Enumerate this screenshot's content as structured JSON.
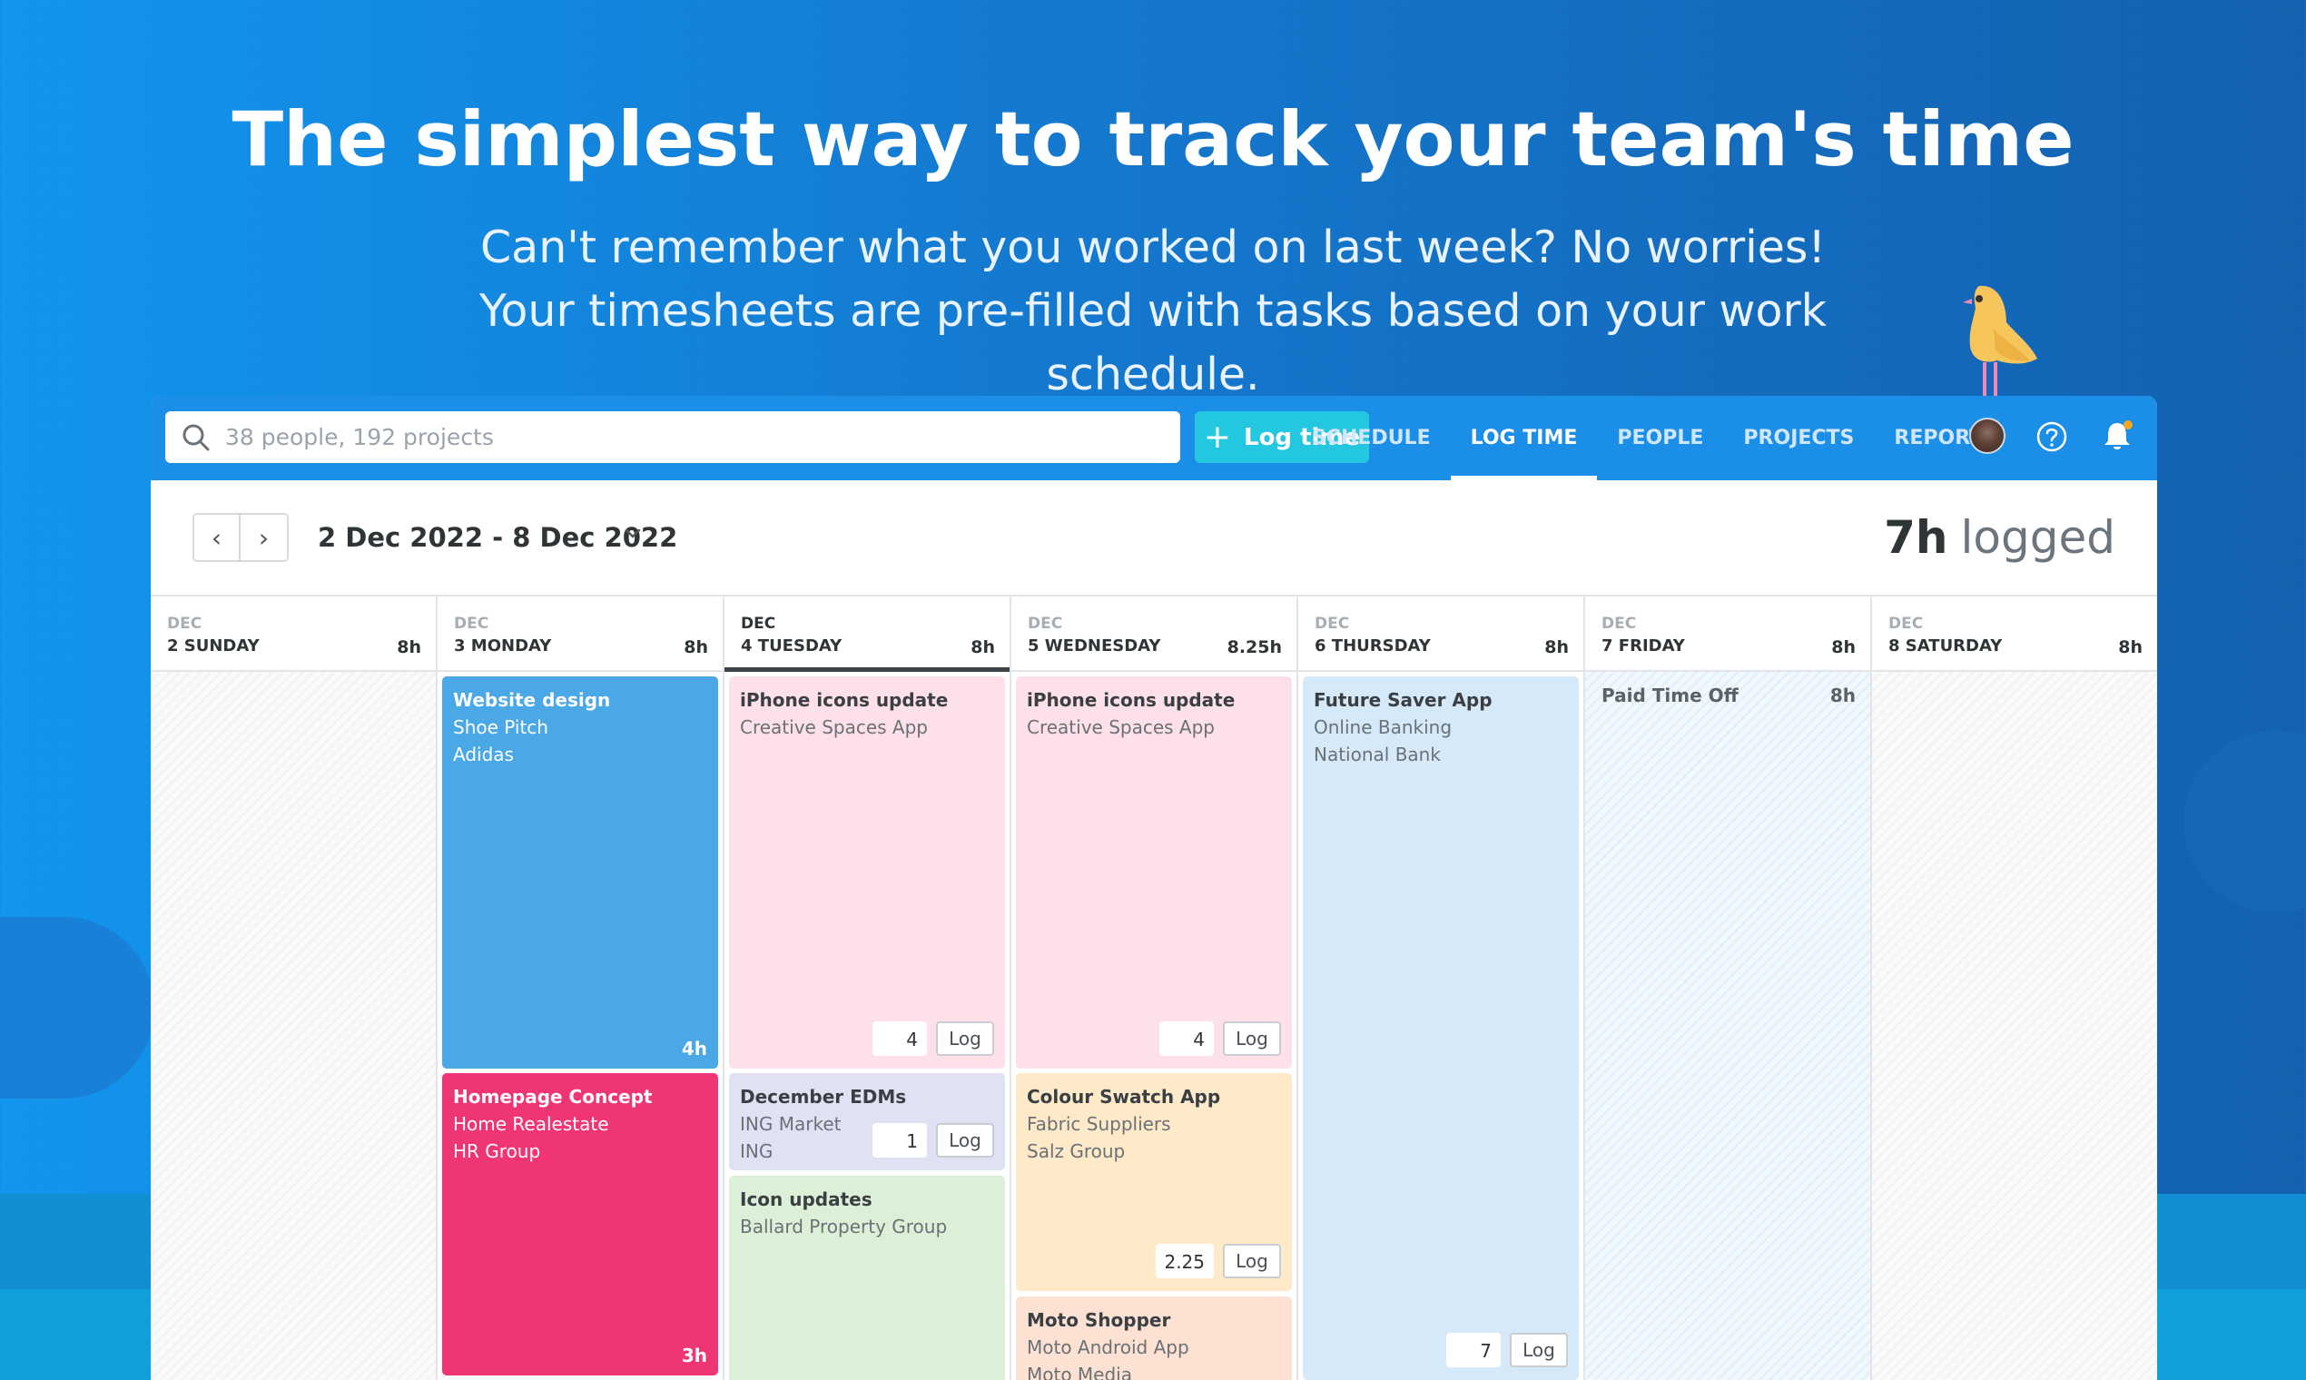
{
  "hero": {
    "title": "The simplest way to track your team's time",
    "subtitle": "Can't remember what you worked on last week? No worries! Your timesheets are pre-filled with tasks based on your work schedule."
  },
  "topbar": {
    "search_placeholder": "38 people, 192 projects",
    "log_button_label": "Log time",
    "nav": [
      "SCHEDULE",
      "LOG TIME",
      "PEOPLE",
      "PROJECTS",
      "REPORTS"
    ],
    "active_nav": "LOG TIME"
  },
  "toolbar": {
    "date_range": "2 Dec 2022 - 8 Dec 2022",
    "logged_value": "7h",
    "logged_label": "logged"
  },
  "days": [
    {
      "month": "DEC",
      "label": "2 SUNDAY",
      "hours": "8h"
    },
    {
      "month": "DEC",
      "label": "3 MONDAY",
      "hours": "8h"
    },
    {
      "month": "DEC",
      "label": "4 TUESDAY",
      "hours": "8h"
    },
    {
      "month": "DEC",
      "label": "5 WEDNESDAY",
      "hours": "8.25h"
    },
    {
      "month": "DEC",
      "label": "6 THURSDAY",
      "hours": "8h"
    },
    {
      "month": "DEC",
      "label": "7 FRIDAY",
      "hours": "8h"
    },
    {
      "month": "DEC",
      "label": "8 SATURDAY",
      "hours": "8h"
    }
  ],
  "tasks": {
    "mon1": {
      "title": "Website design",
      "line1": "Shoe Pitch",
      "line2": "Adidas",
      "hours": "4h"
    },
    "mon2": {
      "title": "Homepage Concept",
      "line1": "Home Realestate",
      "line2": "HR Group",
      "hours": "3h"
    },
    "tue1": {
      "title": "iPhone icons update",
      "line1": "Creative Spaces App",
      "log_value": "4",
      "log_label": "Log"
    },
    "tue2": {
      "title": "December EDMs",
      "line1": "ING Market",
      "line2": "ING",
      "log_value": "1",
      "log_label": "Log"
    },
    "tue3": {
      "title": "Icon updates",
      "line1": "Ballard Property Group"
    },
    "wed1": {
      "title": "iPhone icons update",
      "line1": "Creative Spaces App",
      "log_value": "4",
      "log_label": "Log"
    },
    "wed2": {
      "title": "Colour Swatch App",
      "line1": "Fabric Suppliers",
      "line2": "Salz Group",
      "log_value": "2.25",
      "log_label": "Log"
    },
    "wed3": {
      "title": "Moto Shopper",
      "line1": "Moto Android App",
      "line2": "Moto Media"
    },
    "thu1": {
      "title": "Future Saver App",
      "line1": "Online Banking",
      "line2": "National Bank",
      "log_value": "7",
      "log_label": "Log"
    },
    "fri1": {
      "title": "Paid Time Off",
      "hours": "8h"
    }
  },
  "colors": {
    "brand_blue": "#1b8ee8",
    "accent_cyan": "#24c7e0",
    "task_blue": "#4aa8e6",
    "task_pink_strong": "#ef3576",
    "task_pink_light": "#fde0e8",
    "task_lavender": "#e0e2f3",
    "task_green": "#dcefd7",
    "task_peach": "#fee9c8",
    "task_salmon": "#fde1d2",
    "task_lightblue": "#d6e9f8"
  },
  "icons": [
    "search-icon",
    "plus-icon",
    "avatar",
    "help-icon",
    "bell-icon",
    "chevron-left-icon",
    "chevron-right-icon",
    "chevron-down-icon",
    "bird-illustration"
  ]
}
